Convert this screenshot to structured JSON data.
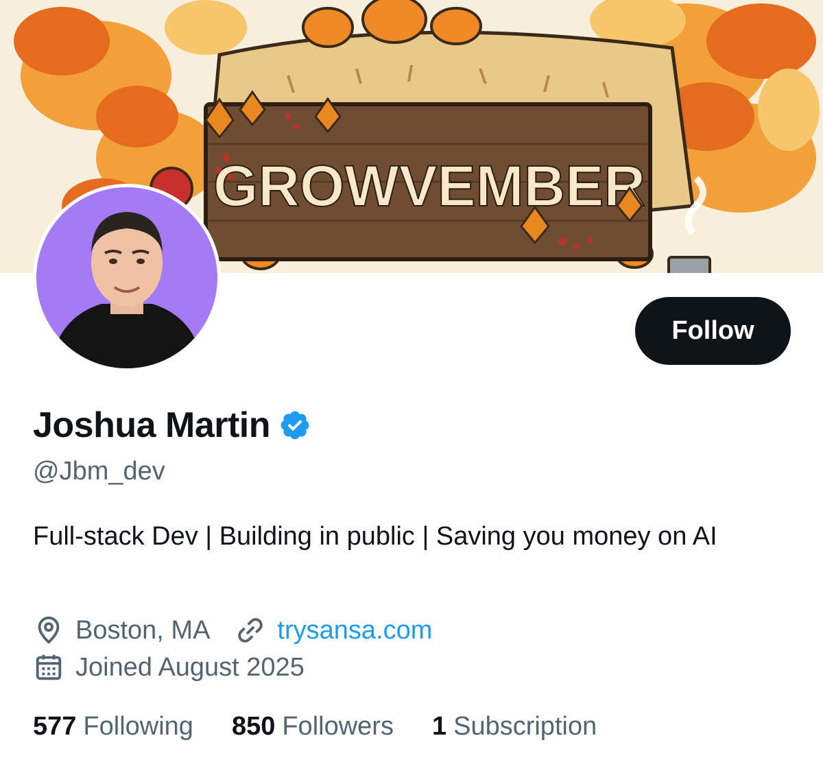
{
  "banner": {
    "sign_text": "GROWVEMBER"
  },
  "profile": {
    "display_name": "Joshua Martin",
    "handle": "@Jbm_dev",
    "bio": "Full-stack Dev | Building in public | Saving you money on AI",
    "location": "Boston, MA",
    "website": "trysansa.com",
    "joined": "Joined August 2025",
    "verified": true
  },
  "actions": {
    "follow_label": "Follow"
  },
  "stats": [
    {
      "count": "577",
      "label": "Following"
    },
    {
      "count": "850",
      "label": "Followers"
    },
    {
      "count": "1",
      "label": "Subscription"
    }
  ],
  "icons": {
    "location": "location-pin-icon",
    "website": "link-icon",
    "joined": "calendar-icon",
    "verified": "verified-badge-icon"
  },
  "colors": {
    "accent": "#1d9bf0",
    "text_primary": "#0f1419",
    "text_secondary": "#536471",
    "button_bg": "#0f1419",
    "avatar_bg": "#a47bf5"
  }
}
